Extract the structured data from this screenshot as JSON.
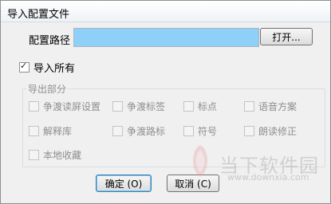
{
  "window": {
    "title": "导入配置文件"
  },
  "path": {
    "label": "配置路径",
    "value": "",
    "open_button": "打开..."
  },
  "import_all": {
    "label": "导入所有",
    "checked": true
  },
  "export_group": {
    "title": "导出部分",
    "options": [
      {
        "label": "争渡读屏设置",
        "checked": false
      },
      {
        "label": "争渡标签",
        "checked": false
      },
      {
        "label": "标点",
        "checked": false
      },
      {
        "label": "语音方案",
        "checked": false
      },
      {
        "label": "解释库",
        "checked": false
      },
      {
        "label": "争渡路标",
        "checked": false
      },
      {
        "label": "符号",
        "checked": false
      },
      {
        "label": "朗读修正",
        "checked": false
      },
      {
        "label": "本地收藏",
        "checked": false
      }
    ]
  },
  "buttons": {
    "ok": "确定 (O)",
    "cancel": "取消 (C)"
  },
  "watermark": {
    "brand": "当下软件园",
    "url": "www.downxia.com"
  },
  "colors": {
    "path_field_bg": "#8fd0f9",
    "ok_focus": "#3c7fb1"
  },
  "icons": [
    "checkmark-icon",
    "watermark-logo-icon"
  ]
}
